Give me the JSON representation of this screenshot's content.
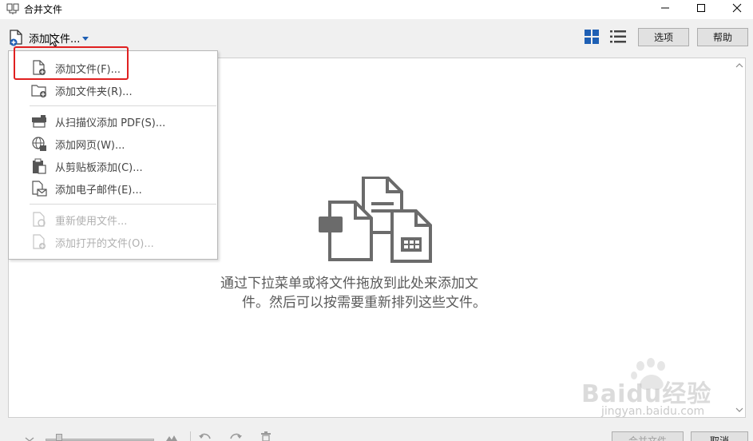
{
  "window": {
    "title": "合并文件"
  },
  "toolbar": {
    "add_files_label": "添加文件...",
    "options_label": "选项",
    "help_label": "帮助"
  },
  "menu": {
    "items": [
      {
        "label": "添加文件(F)...",
        "icon": "add-file-icon",
        "enabled": true
      },
      {
        "label": "添加文件夹(R)...",
        "icon": "add-folder-icon",
        "enabled": true
      },
      {
        "label": "从扫描仪添加 PDF(S)...",
        "icon": "scanner-icon",
        "enabled": true
      },
      {
        "label": "添加网页(W)...",
        "icon": "web-page-icon",
        "enabled": true
      },
      {
        "label": "从剪贴板添加(C)...",
        "icon": "clipboard-icon",
        "enabled": true
      },
      {
        "label": "添加电子邮件(E)...",
        "icon": "email-icon",
        "enabled": true
      },
      {
        "label": "重新使用文件...",
        "icon": "reuse-files-icon",
        "enabled": false
      },
      {
        "label": "添加打开的文件(O)...",
        "icon": "add-open-files-icon",
        "enabled": false
      }
    ]
  },
  "main": {
    "empty_hint_line1": "通过下拉菜单或将文件拖放到此处来添加文",
    "empty_hint_line2": "件。然后可以按需要重新排列这些文件。"
  },
  "bottom": {
    "merge_label": "合并文件",
    "cancel_label": "取消"
  },
  "watermark": {
    "text": "Baidu经验",
    "subtext": "jingyan.baidu.com"
  },
  "colors": {
    "accent": "#1e5fb4",
    "highlight": "#e02020",
    "illustration": "#6b6b6b"
  }
}
